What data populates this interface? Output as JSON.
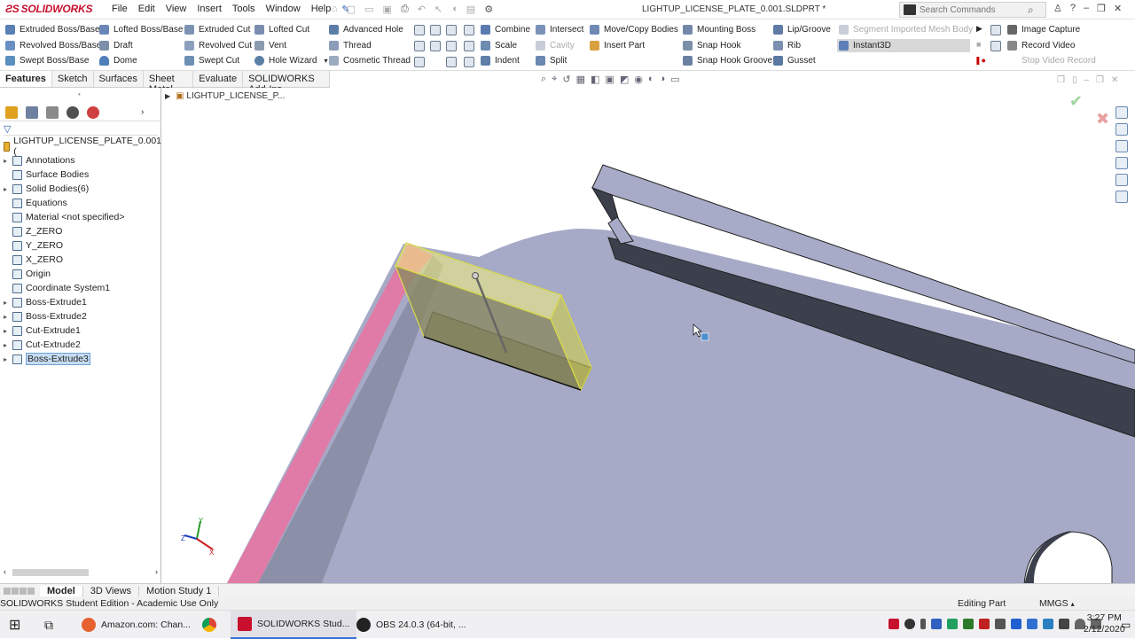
{
  "app": {
    "name": "SOLIDWORKS",
    "doc_title": "LIGHTUP_LICENSE_PLATE_0.001.SLDPRT *"
  },
  "menu": [
    "File",
    "Edit",
    "View",
    "Insert",
    "Tools",
    "Window",
    "Help"
  ],
  "search": {
    "placeholder": "Search Commands"
  },
  "commands": {
    "col1": [
      "Extruded Boss/Base",
      "Revolved Boss/Base",
      "Swept Boss/Base"
    ],
    "col2": [
      "Lofted Boss/Base",
      "Draft",
      "Dome"
    ],
    "col3": [
      "Extruded Cut",
      "Revolved Cut",
      "Swept Cut"
    ],
    "col4": [
      "Lofted Cut",
      "Vent",
      "Hole Wizard"
    ],
    "col5": [
      "Advanced Hole",
      "Thread",
      "Cosmetic Thread"
    ],
    "col6": [
      "Combine",
      "Scale",
      "Indent"
    ],
    "col7": [
      "Intersect",
      "Cavity",
      "Split"
    ],
    "col8": [
      "Move/Copy Bodies",
      "Insert Part"
    ],
    "col9": [
      "Mounting Boss",
      "Snap Hook",
      "Snap Hook Groove"
    ],
    "col10": [
      "Lip/Groove",
      "Rib",
      "Gusset"
    ],
    "col11": [
      "Segment Imported Mesh Body",
      "Instant3D"
    ],
    "col12": [
      "Image Capture",
      "Record Video",
      "Stop Video Record"
    ]
  },
  "tabs": [
    "Features",
    "Sketch",
    "Surfaces",
    "Sheet Metal",
    "Evaluate",
    "SOLIDWORKS Add-Ins"
  ],
  "breadcrumb": "LIGHTUP_LICENSE_P...",
  "tree": {
    "root": "LIGHTUP_LICENSE_PLATE_0.001 (",
    "items": [
      {
        "label": "Annotations",
        "expand": true
      },
      {
        "label": "Surface Bodies",
        "expand": false
      },
      {
        "label": "Solid Bodies(6)",
        "expand": true
      },
      {
        "label": "Equations",
        "expand": false
      },
      {
        "label": "Material <not specified>",
        "expand": false
      },
      {
        "label": "Z_ZERO",
        "expand": false
      },
      {
        "label": "Y_ZERO",
        "expand": false
      },
      {
        "label": "X_ZERO",
        "expand": false
      },
      {
        "label": "Origin",
        "expand": false
      },
      {
        "label": "Coordinate System1",
        "expand": false
      },
      {
        "label": "Boss-Extrude1",
        "expand": true
      },
      {
        "label": "Boss-Extrude2",
        "expand": true
      },
      {
        "label": "Cut-Extrude1",
        "expand": true
      },
      {
        "label": "Cut-Extrude2",
        "expand": true
      },
      {
        "label": "Boss-Extrude3",
        "expand": true
      }
    ]
  },
  "bottom_tabs": [
    "Model",
    "3D Views",
    "Motion Study 1"
  ],
  "status": {
    "left": "SOLIDWORKS Student Edition - Academic Use Only",
    "mode": "Editing Part",
    "units": "MMGS"
  },
  "taskbar": {
    "apps": [
      "Amazon.com: Chan...",
      "SOLIDWORKS Stud...",
      "OBS 24.0.3 (64-bit, ..."
    ],
    "time": "3:27 PM",
    "date": "2/12/2020"
  },
  "colors": {
    "model": "#a7abc7",
    "pink_face": "#e07aa6",
    "dark_face": "#3c3f4c",
    "highlight": "#f0f06a",
    "accent": "#c8102e"
  }
}
